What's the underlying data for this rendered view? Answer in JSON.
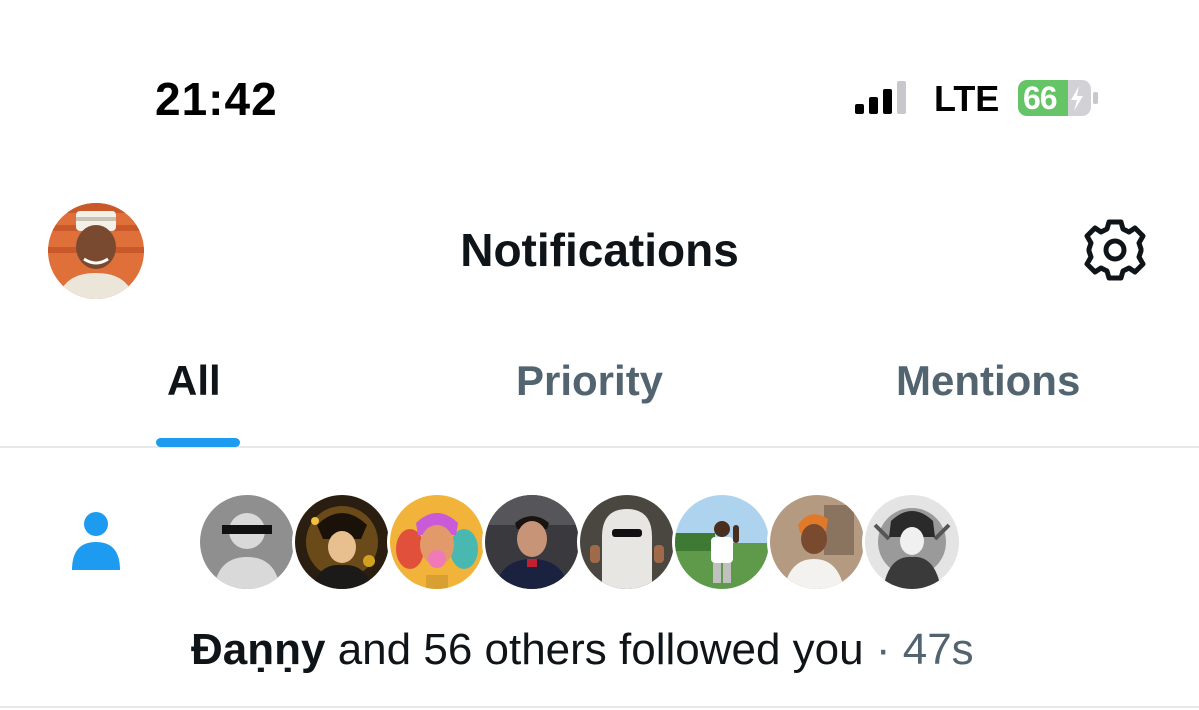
{
  "status_bar": {
    "time": "21:42",
    "network": "LTE",
    "battery_percent": "66",
    "signal_bars_active": 3,
    "signal_bars_total": 4,
    "battery_color": "#65c466"
  },
  "header": {
    "title": "Notifications",
    "avatar_icon": "profile-avatar",
    "settings_icon": "gear-icon"
  },
  "tabs": [
    {
      "label": "All",
      "active": true
    },
    {
      "label": "Priority",
      "active": false
    },
    {
      "label": "Mentions",
      "active": false
    }
  ],
  "accent_color": "#1d9bf0",
  "notification": {
    "icon": "person-icon",
    "actor": "Đaṇṇy",
    "message": " and 56 others followed you",
    "separator": " · ",
    "time": "47s",
    "follower_avatars": [
      "follower-1",
      "follower-2",
      "follower-3",
      "follower-4",
      "follower-5",
      "follower-6",
      "follower-7",
      "follower-8"
    ]
  }
}
